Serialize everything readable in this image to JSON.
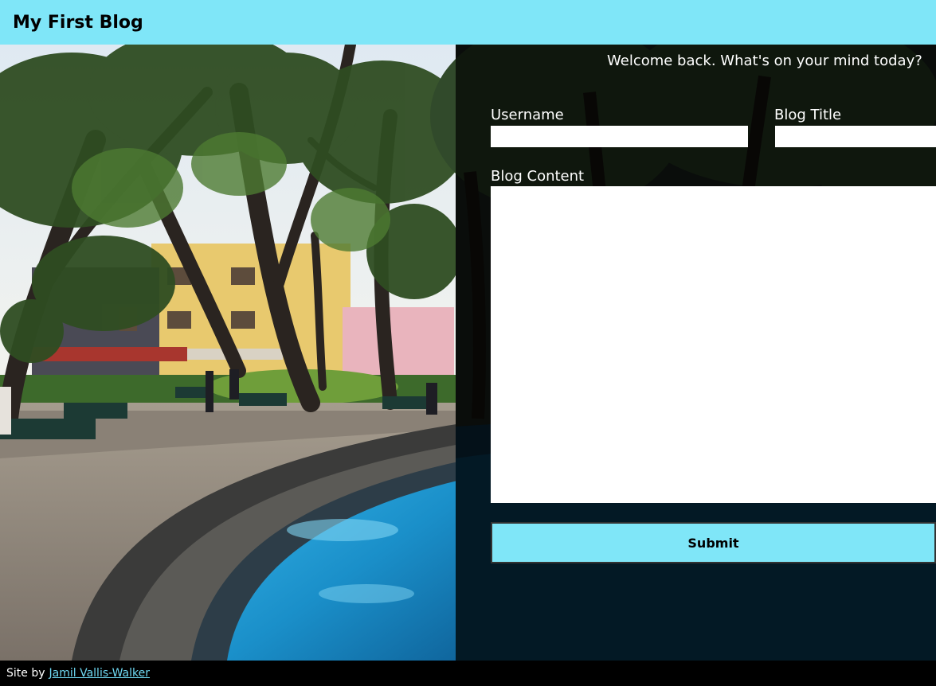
{
  "header": {
    "title": "My First Blog"
  },
  "form": {
    "welcome": "Welcome back. What's on your mind today?",
    "username_label": "Username",
    "username_value": "",
    "blog_title_label": "Blog Title",
    "blog_title_value": "",
    "content_label": "Blog Content",
    "content_value": "",
    "submit_label": "Submit"
  },
  "footer": {
    "prefix": "Site by",
    "author_link": "Jamil Vallis-Walker"
  },
  "colors": {
    "accent": "#7fe6f8",
    "footer_link": "#6fd9f3",
    "water": "#1aa0d6"
  }
}
